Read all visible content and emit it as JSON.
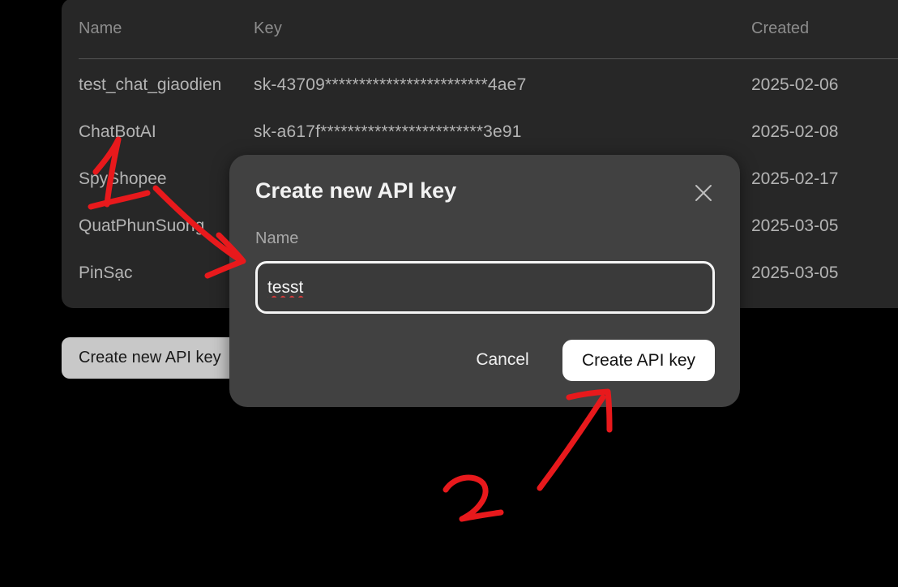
{
  "table": {
    "headers": {
      "name": "Name",
      "key": "Key",
      "created": "Created"
    },
    "rows": [
      {
        "name": "test_chat_giaodien",
        "key": "sk-43709************************4ae7",
        "created": "2025-02-06"
      },
      {
        "name": "ChatBotAI",
        "key": "sk-a617f************************3e91",
        "created": "2025-02-08"
      },
      {
        "name": "SpyShopee",
        "key": "",
        "created": "2025-02-17"
      },
      {
        "name": "QuatPhunSuong",
        "key": "",
        "created": "2025-03-05"
      },
      {
        "name": "PinSạc",
        "key": "",
        "created": "2025-03-05"
      }
    ]
  },
  "page_button": {
    "label": "Create new API key"
  },
  "modal": {
    "title": "Create new API key",
    "field_label": "Name",
    "input_value": "tesst",
    "cancel_label": "Cancel",
    "confirm_label": "Create API key"
  },
  "annotations": {
    "color": "#e8191c",
    "step_1_label": "1",
    "step_2_label": "2"
  },
  "colors": {
    "background": "#000000",
    "panel": "#2a2a2a",
    "modal": "#414141",
    "button_primary": "#ffffff"
  }
}
